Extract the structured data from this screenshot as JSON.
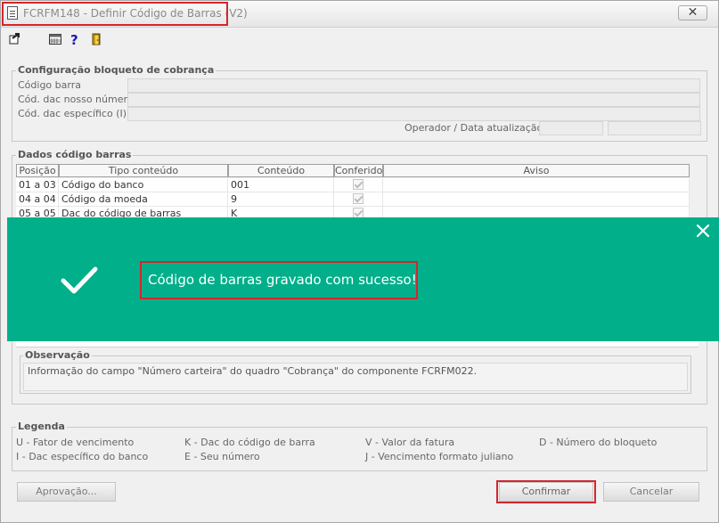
{
  "window": {
    "title": "FCRFM148 - Definir Código de Barras (V2)",
    "close_glyph": "✕"
  },
  "toolbar": {
    "items": [
      "export-icon",
      "calendar-icon",
      "help-icon",
      "exit-door-icon"
    ]
  },
  "config": {
    "legend": "Configuração bloqueto de cobrança",
    "labels": [
      "Código barra",
      "Cód. dac nosso número",
      "Cód. dac específico (I)"
    ],
    "operador_label": "Operador / Data atualização"
  },
  "dados": {
    "legend": "Dados código barras",
    "columns": [
      "Posição",
      "Tipo conteúdo",
      "Conteúdo",
      "Conferido",
      "Aviso"
    ],
    "rows": [
      {
        "posicao": "01 a 03",
        "tipo": "Código do banco",
        "conteudo": "001",
        "conferido": true,
        "aviso": ""
      },
      {
        "posicao": "04 a 04",
        "tipo": "Código da moeda",
        "conteudo": "9",
        "conferido": true,
        "aviso": ""
      },
      {
        "posicao": "05 a 05",
        "tipo": "Dac do código de barras",
        "conteudo": "K",
        "conferido": true,
        "aviso": ""
      }
    ]
  },
  "toast": {
    "message": "Código de barras gravado com sucesso!",
    "color": "#01af8a"
  },
  "observacao": {
    "legend": "Observação",
    "text": "Informação do campo \"Número carteira\" do quadro \"Cobrança\" do componente FCRFM022."
  },
  "legenda": {
    "legend": "Legenda",
    "items": [
      "U - Fator de vencimento",
      "K - Dac do código de barra",
      "V - Valor da fatura",
      "D - Número do bloqueto",
      "I - Dac específico do banco",
      "E - Seu número",
      "J - Vencimento formato juliano"
    ]
  },
  "buttons": {
    "aprovacao": "Aprovação...",
    "confirmar": "Confirmar",
    "cancelar": "Cancelar"
  },
  "colors": {
    "highlight": "#d3272b"
  }
}
